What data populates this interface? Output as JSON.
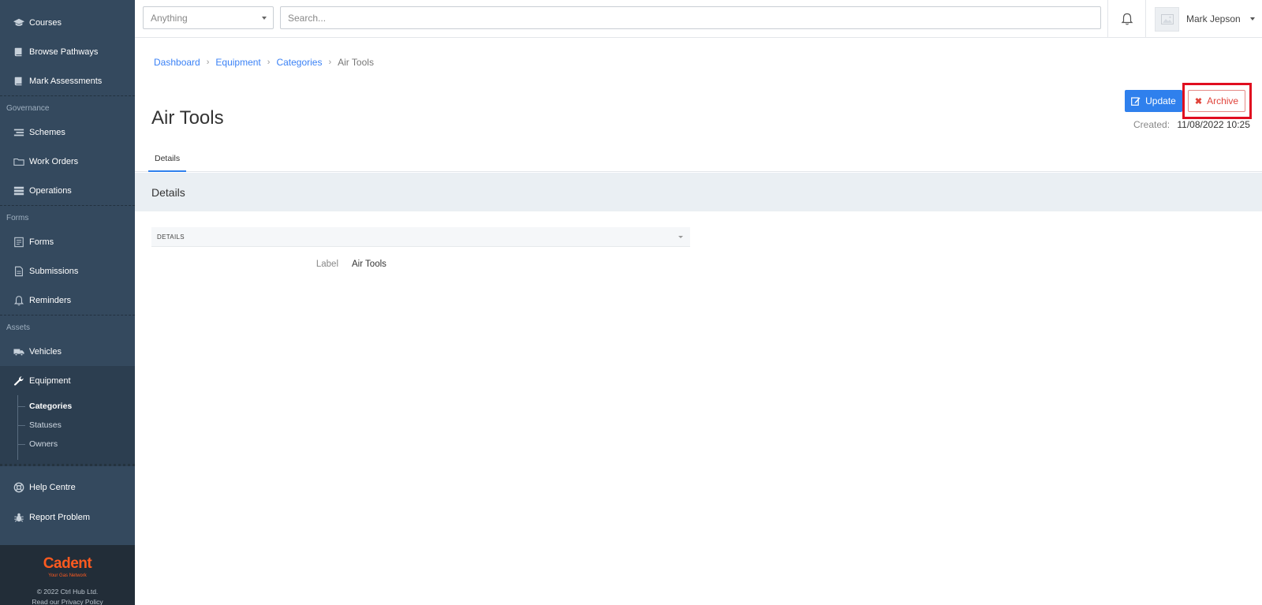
{
  "sidebar": {
    "top_items": [
      {
        "label": "Courses",
        "icon": "graduation-cap-icon"
      },
      {
        "label": "Browse Pathways",
        "icon": "book-icon"
      },
      {
        "label": "Mark Assessments",
        "icon": "book-icon"
      }
    ],
    "governance": {
      "title": "Governance",
      "items": [
        {
          "label": "Schemes",
          "icon": "list-icon"
        },
        {
          "label": "Work Orders",
          "icon": "folder-icon"
        },
        {
          "label": "Operations",
          "icon": "stack-icon"
        }
      ]
    },
    "forms": {
      "title": "Forms",
      "items": [
        {
          "label": "Forms",
          "icon": "form-icon"
        },
        {
          "label": "Submissions",
          "icon": "document-icon"
        },
        {
          "label": "Reminders",
          "icon": "bell-icon"
        }
      ]
    },
    "assets": {
      "title": "Assets",
      "items": [
        {
          "label": "Vehicles",
          "icon": "truck-icon"
        },
        {
          "label": "Equipment",
          "icon": "wrench-icon"
        }
      ],
      "equipment_sub": [
        "Categories",
        "Statuses",
        "Owners"
      ]
    },
    "help_items": [
      {
        "label": "Help Centre",
        "icon": "life-ring-icon"
      },
      {
        "label": "Report Problem",
        "icon": "bug-icon"
      }
    ],
    "brand": {
      "logo": "Cadent",
      "tagline": "Your Gas Network",
      "copyright": "© 2022 Ctrl Hub Ltd.",
      "privacy": "Read our Privacy Policy"
    }
  },
  "topbar": {
    "filter_value": "Anything",
    "search_placeholder": "Search...",
    "user_name": "Mark Jepson"
  },
  "breadcrumb": {
    "items": [
      "Dashboard",
      "Equipment",
      "Categories"
    ],
    "current": "Air Tools"
  },
  "page": {
    "title": "Air Tools",
    "update_label": "Update",
    "archive_label": "Archive",
    "created_label": "Created:",
    "created_value": "11/08/2022 10:25",
    "tab": "Details",
    "section_title": "Details",
    "panel_title": "DETAILS",
    "fields": [
      {
        "label": "Label",
        "value": "Air Tools"
      }
    ]
  },
  "colors": {
    "sidebar": "#34495e",
    "primary": "#2f80ed",
    "danger": "#e0443b",
    "highlight": "#e00d1f",
    "brand": "#ff5a1f"
  }
}
